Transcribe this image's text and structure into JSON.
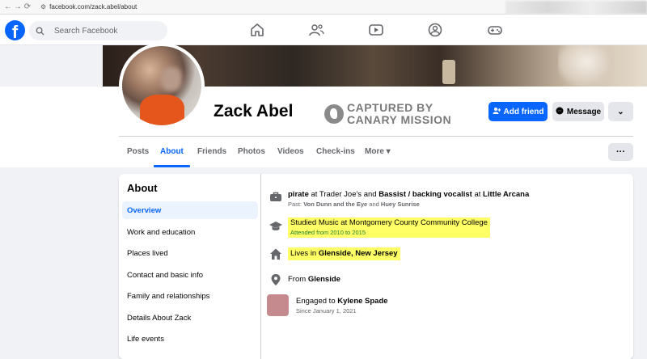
{
  "browser": {
    "url": "facebook.com/zack.abel/about",
    "back": "←",
    "forward": "→",
    "reload": "⟳",
    "site_icon": "⚙"
  },
  "topbar": {
    "logo": "f",
    "search_placeholder": "Search Facebook",
    "icons": [
      "home-icon",
      "friends-icon",
      "watch-icon",
      "groups-icon",
      "gaming-icon"
    ]
  },
  "profile": {
    "name": "Zack Abel",
    "overlay_line1": "CAPTURED BY",
    "overlay_line2": "CANARY MISSION",
    "add_friend": "Add friend",
    "message": "Message",
    "more_chevron": "⌄"
  },
  "tabs": [
    "Posts",
    "About",
    "Friends",
    "Photos",
    "Videos",
    "Check-ins",
    "More ▾"
  ],
  "more_dots": "···",
  "about": {
    "title": "About",
    "sidebar": [
      "Overview",
      "Work and education",
      "Places lived",
      "Contact and basic info",
      "Family and relationships",
      "Details About Zack",
      "Life events"
    ],
    "work": {
      "role1": "pirate",
      "at1": " at ",
      "place1": "Trader Joe's",
      "and": " and ",
      "role2": "Bassist / backing vocalist",
      "at2": " at ",
      "place2": "Little Arcana",
      "past_label": "Past: ",
      "past1": "Von Dunn and the Eye",
      "past_and": " and ",
      "past2": "Huey Sunrise"
    },
    "education": {
      "line": "Studied Music at Montgomery County Community College",
      "sub": "Attended from 2010 to 2015"
    },
    "lives": {
      "prefix": "Lives in ",
      "place": "Glenside, New Jersey"
    },
    "from": {
      "prefix": "From ",
      "place": "Glenside"
    },
    "relationship": {
      "prefix": "Engaged to ",
      "person": "Kylene Spade",
      "since": "Since January 1, 2021"
    }
  }
}
